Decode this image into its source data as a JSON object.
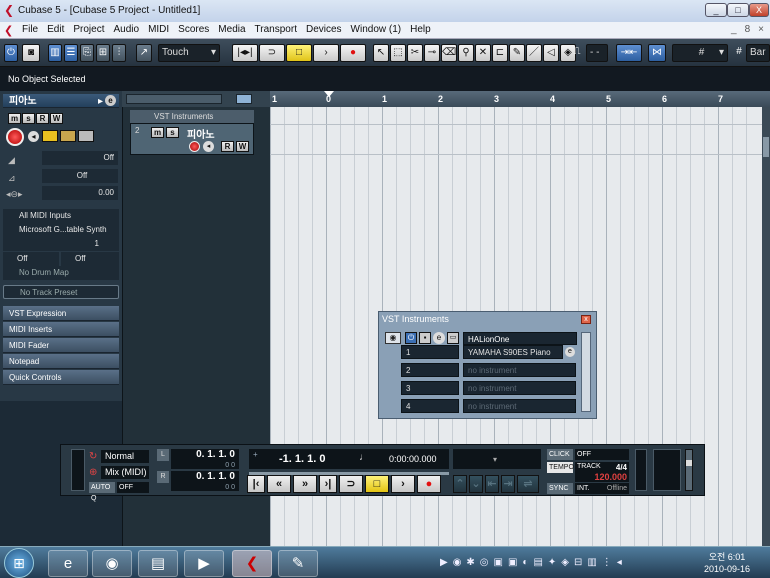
{
  "window": {
    "title": "Cubase 5 - [Cubase 5 Project - Untitled1]",
    "min": "_",
    "max": "□",
    "close": "X"
  },
  "menu": {
    "items": [
      "File",
      "Edit",
      "Project",
      "Audio",
      "MIDI",
      "Scores",
      "Media",
      "Transport",
      "Devices",
      "Window (1)",
      "Help"
    ],
    "doc_controls": [
      "_",
      "8",
      "×"
    ]
  },
  "toolbar": {
    "automation_mode": "Touch",
    "grid_label": "Bar",
    "quantize_value": "- -"
  },
  "infoline": {
    "text": "No Object Selected"
  },
  "inspector": {
    "track_name": "피아노",
    "buttons": {
      "mute": "m",
      "solo": "s",
      "read": "R",
      "write": "W"
    },
    "volume_value": "Off",
    "pan_value": "Off",
    "delay_value": "0.00",
    "input_routing": "All MIDI Inputs",
    "output_routing": "Microsoft G...table Synth",
    "channel": "1",
    "bank": "Off",
    "program": "Off",
    "drum_map": "No Drum Map",
    "track_preset": "No Track Preset",
    "sections": [
      "VST Expression",
      "MIDI Inserts",
      "MIDI Fader",
      "Notepad",
      "Quick Controls"
    ]
  },
  "tracklist": {
    "folder_name": "VST Instruments",
    "track_number": "2",
    "track_name": "피아노",
    "btn_m": "m",
    "btn_s": "s",
    "btn_r": "R",
    "btn_w": "W"
  },
  "ruler": {
    "ticks": [
      "1",
      "0",
      "1",
      "2",
      "3",
      "4",
      "5",
      "6",
      "7"
    ]
  },
  "vst_window": {
    "title": "VST Instruments",
    "close": "x",
    "header_instrument": "HALionOne",
    "slots": [
      {
        "num": "1",
        "name": "YAMAHA S90ES Piano",
        "muted": false
      },
      {
        "num": "2",
        "name": "no instrument",
        "muted": true
      },
      {
        "num": "3",
        "name": "no instrument",
        "muted": true
      },
      {
        "num": "4",
        "name": "no instrument",
        "muted": true
      }
    ]
  },
  "transport": {
    "mode_normal": "Normal",
    "mode_mix": "Mix (MIDI)",
    "autoq": "AUTO Q",
    "autoq_value": "OFF",
    "left_locator": "0. 1. 1.    0",
    "left_sub": "0    0",
    "right_locator": "0. 1. 1.    0",
    "right_sub": "0    0",
    "primary_time": "-1. 1. 1.    0",
    "secondary_time": "0:00:00.000",
    "click_label": "CLICK",
    "click_value": "OFF",
    "tempo_label": "TEMPO",
    "tempo_mode": "TRACK",
    "signature": "4/4",
    "tempo_value": "120.000",
    "sync_label": "SYNC",
    "sync_mode": "INT.",
    "sync_status": "Offline"
  },
  "taskbar": {
    "time": "오전 6:01",
    "date": "2010-09-16"
  }
}
